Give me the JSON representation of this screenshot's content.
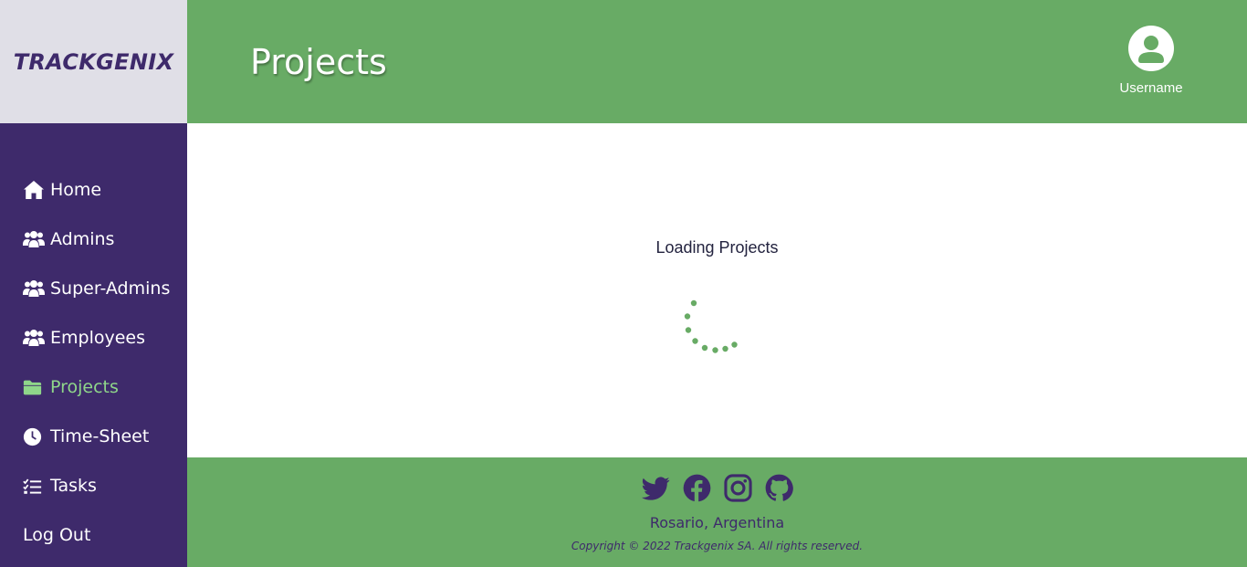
{
  "app": {
    "logo": "TRACKGENIX",
    "page_title": "Projects",
    "user": {
      "name": "Username",
      "icon": "user-circle-icon"
    }
  },
  "sidebar": {
    "items": [
      {
        "label": "Home",
        "icon": "home-icon",
        "active": false
      },
      {
        "label": "Admins",
        "icon": "users-icon",
        "active": false
      },
      {
        "label": "Super-Admins",
        "icon": "users-icon",
        "active": false
      },
      {
        "label": "Employees",
        "icon": "users-icon",
        "active": false
      },
      {
        "label": "Projects",
        "icon": "folder-icon",
        "active": true
      },
      {
        "label": "Time-Sheet",
        "icon": "clock-icon",
        "active": false
      },
      {
        "label": "Tasks",
        "icon": "list-check-icon",
        "active": false
      },
      {
        "label": "Log Out",
        "icon": "",
        "active": false
      }
    ]
  },
  "main": {
    "loading_text": "Loading Projects",
    "spinner_icon": "loading-spinner-icon"
  },
  "footer": {
    "social": [
      {
        "name": "twitter-icon"
      },
      {
        "name": "facebook-icon"
      },
      {
        "name": "instagram-icon"
      },
      {
        "name": "github-icon"
      }
    ],
    "location": "Rosario, Argentina",
    "copyright": "Copyright © 2022 Trackgenix SA. All rights reserved."
  },
  "colors": {
    "primary_green": "#68ab65",
    "primary_purple": "#3e2a6b",
    "logo_background": "#e0dfe7",
    "active_link": "#8fd68a"
  }
}
